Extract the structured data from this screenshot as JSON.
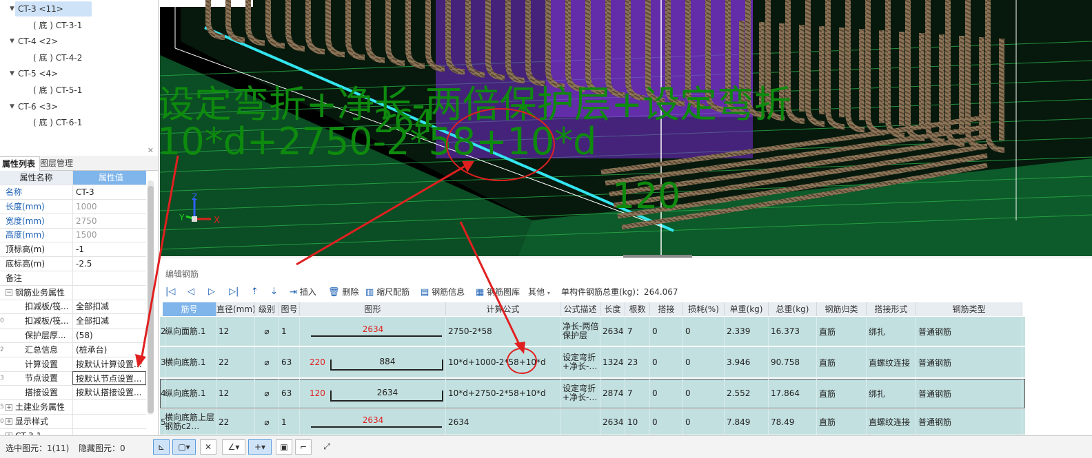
{
  "tree": [
    {
      "label": "CT-3 <11>",
      "type": "group",
      "selected": true
    },
    {
      "label": "( 底 ) CT-3-1",
      "type": "item"
    },
    {
      "label": "CT-4 <2>",
      "type": "group"
    },
    {
      "label": "( 底 ) CT-4-2",
      "type": "item"
    },
    {
      "label": "CT-5 <4>",
      "type": "group"
    },
    {
      "label": "( 底 ) CT-5-1",
      "type": "item"
    },
    {
      "label": "CT-6 <3>",
      "type": "group"
    },
    {
      "label": "( 底 ) CT-6-1",
      "type": "item"
    }
  ],
  "props_tabs": [
    "属性列表",
    "图层管理"
  ],
  "props_header": {
    "name": "属性名称",
    "value": "属性值"
  },
  "props": [
    {
      "num": "",
      "name": "名称",
      "value": "CT-3",
      "nameblue": true
    },
    {
      "num": "",
      "name": "长度(mm)",
      "value": "1000",
      "nameblue": true,
      "grey": true
    },
    {
      "num": "",
      "name": "宽度(mm)",
      "value": "2750",
      "nameblue": true,
      "grey": true
    },
    {
      "num": "",
      "name": "高度(mm)",
      "value": "1500",
      "nameblue": true,
      "grey": true
    },
    {
      "num": "",
      "name": "顶标高(m)",
      "value": "-1"
    },
    {
      "num": "",
      "name": "底标高(m)",
      "value": "-2.5"
    },
    {
      "num": "",
      "name": "备注",
      "value": ""
    },
    {
      "num": "",
      "name": "钢筋业务属性",
      "value": "",
      "expand": "−"
    },
    {
      "num": "",
      "name": "扣减板/筏...",
      "value": "全部扣减",
      "indent": true
    },
    {
      "num": "0",
      "name": "扣减板/筏...",
      "value": "全部扣减",
      "indent": true
    },
    {
      "num": "",
      "name": "保护层厚...",
      "value": "(58)",
      "indent": true
    },
    {
      "num": "2",
      "name": "汇总信息",
      "value": "(桩承台)",
      "indent": true
    },
    {
      "num": "",
      "name": "计算设置",
      "value": "按默认计算设置...",
      "indent": true
    },
    {
      "num": "3",
      "name": "节点设置",
      "value": "按默认节点设置...",
      "indent": true,
      "hilite": true
    },
    {
      "num": "",
      "name": "搭接设置",
      "value": "按默认搭接设置...",
      "indent": true
    },
    {
      "num": "5",
      "name": "土建业务属性",
      "value": "",
      "expand": "+"
    },
    {
      "num": "0",
      "name": "显示样式",
      "value": "",
      "expand": "+"
    },
    {
      "num": "",
      "name": "CT-3-1",
      "value": "",
      "expand": "+"
    }
  ],
  "view": {
    "formula_text": "设定弯折+净长-两倍保护层+设定弯折",
    "calc_text": "10*d+2750-2*58+10*d",
    "num_264": "264",
    "num_120": "120",
    "axis_x": "X",
    "axis_y": "Y",
    "axis_z": "Z"
  },
  "editor": {
    "title": "编辑钢筋",
    "toolbar": {
      "insert": "插入",
      "delete": "删除",
      "scale": "缩尺配筋",
      "info": "钢筋信息",
      "library": "钢筋图库",
      "other": "其他",
      "total": "单构件钢筋总重(kg)：264.067"
    },
    "columns": [
      "筋号",
      "直径(mm)",
      "级别",
      "图号",
      "图形",
      "计算公式",
      "公式描述",
      "长度",
      "根数",
      "搭接",
      "损耗(%)",
      "单重(kg)",
      "总重(kg)",
      "钢筋归类",
      "搭接形式",
      "钢筋类型"
    ],
    "rows": [
      {
        "idx": "2",
        "name": "纵向面筋.1",
        "dia": "12",
        "grade": "⌀",
        "fig": "1",
        "shape_main": "2634",
        "shape_left": "",
        "formula": "2750-2*58",
        "desc": "净长-两倍保护层",
        "len": "2634",
        "count": "7",
        "lap": "0",
        "loss": "0",
        "unit": "2.339",
        "total": "16.373",
        "cat": "直筋",
        "lapform": "绑扎",
        "type": "普通钢筋"
      },
      {
        "idx": "3",
        "name": "横向底筋.1",
        "dia": "22",
        "grade": "⌀",
        "fig": "63",
        "shape_main": "884",
        "shape_left": "220",
        "formula": "10*d+1000-2*58+10*d",
        "desc": "设定弯折+净长-…",
        "len": "1324",
        "count": "23",
        "lap": "0",
        "loss": "0",
        "unit": "3.946",
        "total": "90.758",
        "cat": "直筋",
        "lapform": "直螺纹连接",
        "type": "普通钢筋"
      },
      {
        "idx": "4",
        "name": "纵向底筋.1",
        "dia": "12",
        "grade": "⌀",
        "fig": "63",
        "shape_main": "2634",
        "shape_left": "120",
        "formula": "10*d+2750-2*58+10*d",
        "desc": "设定弯折+净长-…",
        "len": "2874",
        "count": "7",
        "lap": "0",
        "loss": "0",
        "unit": "2.552",
        "total": "17.864",
        "cat": "直筋",
        "lapform": "绑扎",
        "type": "普通钢筋"
      },
      {
        "idx": "5",
        "name": "横向底筋上层钢筋c2…",
        "dia": "22",
        "grade": "⌀",
        "fig": "1",
        "shape_main": "2634",
        "shape_left": "",
        "formula": "2634",
        "desc": "",
        "len": "2634",
        "count": "10",
        "lap": "0",
        "loss": "0",
        "unit": "7.849",
        "total": "78.49",
        "cat": "直筋",
        "lapform": "直螺纹连接",
        "type": "普通钢筋"
      }
    ]
  },
  "status": {
    "selected": "选中图元：1(11)",
    "hidden": "隐藏图元：0"
  },
  "colors": {
    "accent": "#7fb5ea",
    "row": "#c3e0e0",
    "annotation": "#e02020",
    "overlay_text": "#0e8a0e"
  }
}
